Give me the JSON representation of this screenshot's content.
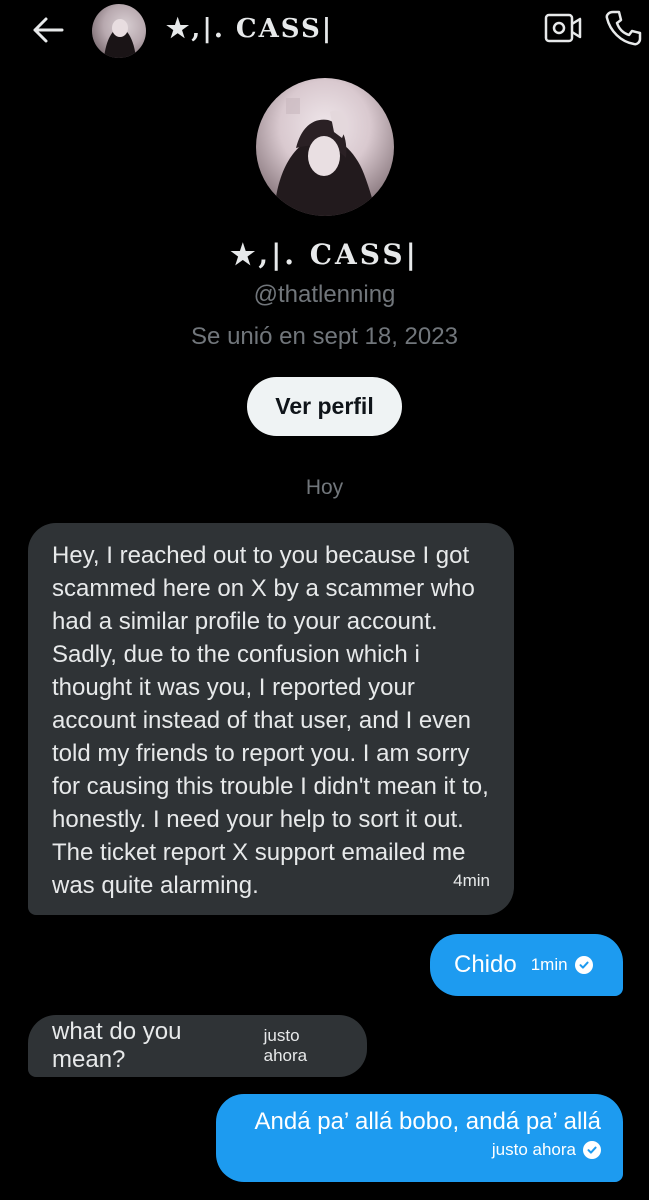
{
  "header": {
    "contact_name": "★,|. CASS|"
  },
  "profile": {
    "name": "★,|. CASS|",
    "handle": "@thatlenning",
    "joined": "Se unió en sept 18, 2023",
    "view_profile_label": "Ver perfil"
  },
  "date_separator": "Hoy",
  "messages": [
    {
      "direction": "incoming",
      "text": "Hey, I reached out to you because I got scammed here on X by a scammer who had a similar profile to your account. Sadly, due to the confusion which i thought it was you, I reported your account instead of that user, and I even told my friends to report you. I am sorry for causing this trouble I didn't mean it to, honestly. I need your help to sort it out. The ticket report X support emailed me was quite alarming.",
      "time": "4min"
    },
    {
      "direction": "outgoing",
      "text": "Chido",
      "time": "1min",
      "status_icon": "read-check-icon"
    },
    {
      "direction": "incoming",
      "text": "what do you mean?",
      "time": "justo ahora"
    },
    {
      "direction": "outgoing",
      "text": "Andá pa’ allá bobo, andá pa’ allá",
      "time": "justo ahora",
      "status_icon": "read-check-icon"
    }
  ],
  "colors": {
    "background": "#000000",
    "incoming_bubble": "#2f3336",
    "outgoing_bubble": "#1d9bf0",
    "secondary_text": "#71767b"
  }
}
